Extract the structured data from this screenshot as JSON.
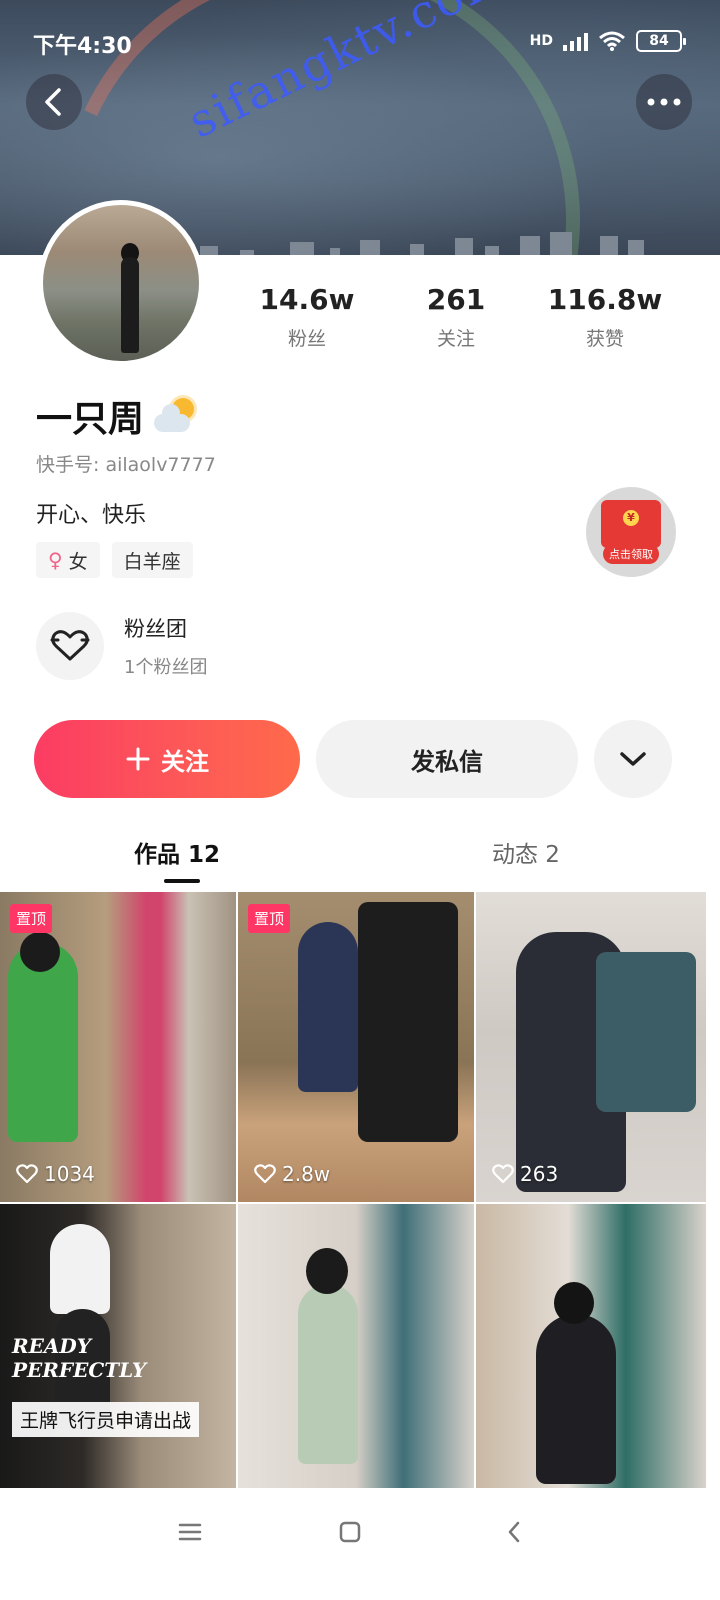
{
  "status_bar": {
    "time": "下午4:30",
    "network": "HD",
    "battery": "84"
  },
  "header": {
    "watermark": "sifangktv.com"
  },
  "profile": {
    "stats": [
      {
        "value": "14.6w",
        "label": "粉丝"
      },
      {
        "value": "261",
        "label": "关注"
      },
      {
        "value": "116.8w",
        "label": "获赞"
      }
    ],
    "name": "一只周",
    "kuaishou_id": "快手号: ailaolv7777",
    "bio": "开心、快乐",
    "tags": {
      "gender": "女",
      "zodiac": "白羊座"
    },
    "red_packet_label": "点击领取",
    "fan_club": {
      "title": "粉丝团",
      "subtitle": "1个粉丝团"
    }
  },
  "actions": {
    "follow_label": "关注",
    "message_label": "发私信"
  },
  "tabs": {
    "works": "作品 12",
    "moments": "动态 2"
  },
  "grid": [
    {
      "pinned": "置顶",
      "likes": "1034"
    },
    {
      "pinned": "置顶",
      "likes": "2.8w"
    },
    {
      "pinned": "",
      "likes": "263"
    },
    {
      "caption": "王牌飞行员申请出战",
      "overlay": "READY PERFECTLY"
    },
    {},
    {}
  ],
  "colors": {
    "follow_gradient_start": "#fb3c63",
    "follow_gradient_end": "#ff6a4a",
    "pin_badge": "#fe3666",
    "female": "#f0648c"
  }
}
